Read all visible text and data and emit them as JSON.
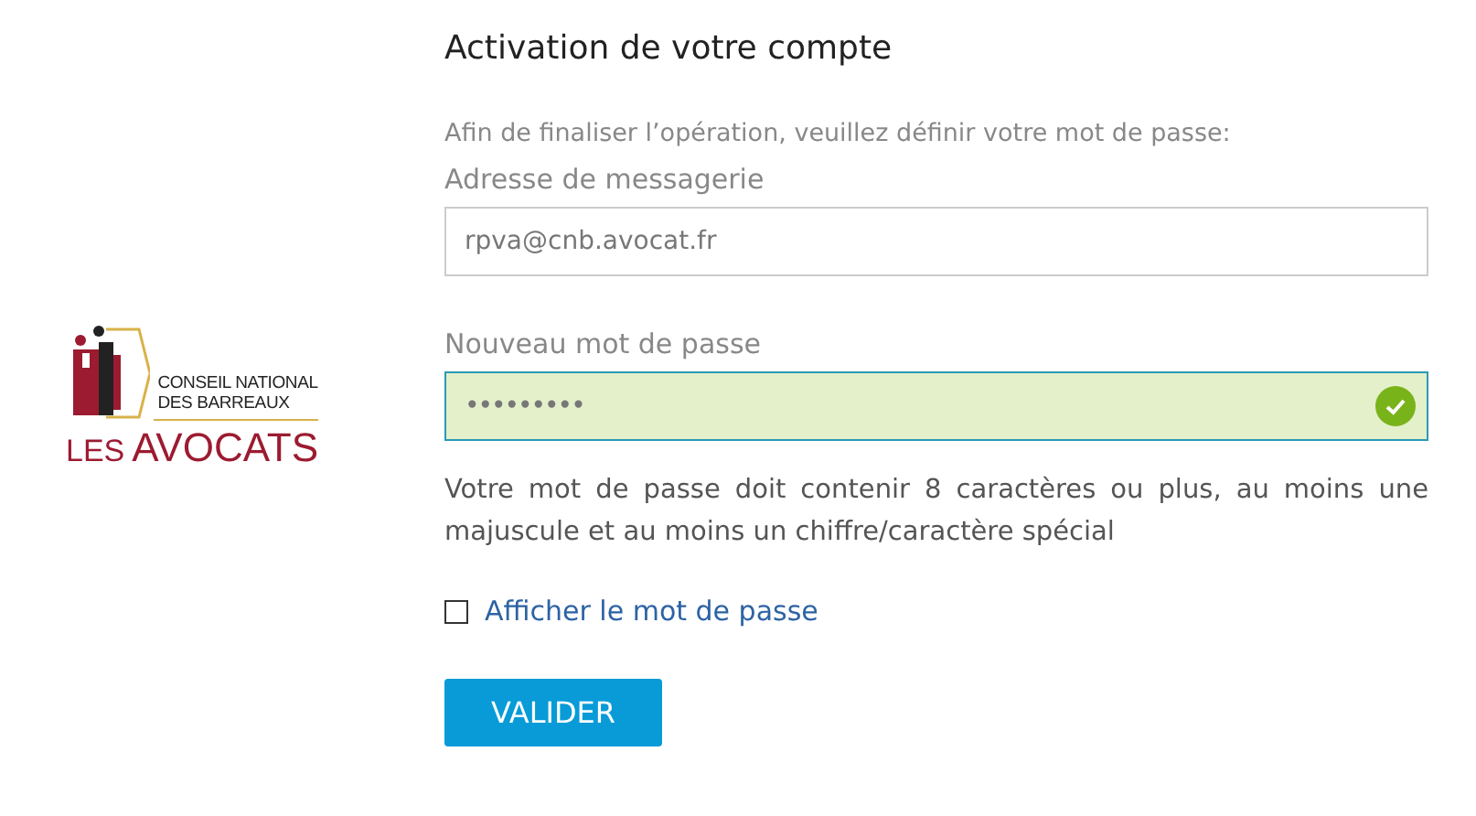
{
  "logo": {
    "line_1": "CONSEIL NATIONAL",
    "line_2": "DES BARREAUX",
    "brand_prefix": "LES",
    "brand": "AVOCATS"
  },
  "title": "Activation de votre compte",
  "instruction": "Afin de finaliser l’opération, veuillez définir votre mot de passe:",
  "email": {
    "label": "Adresse de messagerie",
    "value": "rpva@cnb.avocat.fr"
  },
  "password": {
    "label": "Nouveau mot de passe",
    "value": "•••••••••",
    "valid": true
  },
  "help": "Votre mot de passe doit contenir 8 caractères ou plus, au moins une majuscule et au moins un chiffre/caractère spécial",
  "show_password": {
    "label": "Afficher le mot de passe",
    "checked": false
  },
  "submit": "VALIDER"
}
